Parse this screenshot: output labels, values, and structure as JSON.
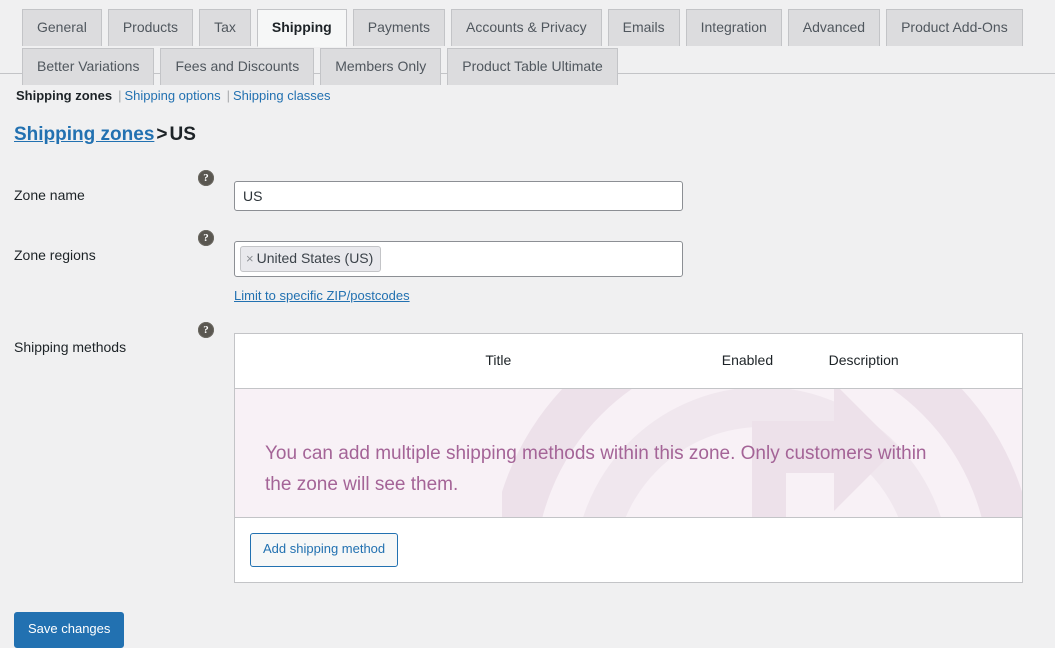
{
  "tabs": {
    "row1": [
      {
        "label": "General",
        "active": false
      },
      {
        "label": "Products",
        "active": false
      },
      {
        "label": "Tax",
        "active": false
      },
      {
        "label": "Shipping",
        "active": true
      },
      {
        "label": "Payments",
        "active": false
      },
      {
        "label": "Accounts & Privacy",
        "active": false
      },
      {
        "label": "Emails",
        "active": false
      },
      {
        "label": "Integration",
        "active": false
      },
      {
        "label": "Advanced",
        "active": false
      },
      {
        "label": "Product Add-Ons",
        "active": false
      }
    ],
    "row2": [
      {
        "label": "Better Variations",
        "active": false
      },
      {
        "label": "Fees and Discounts",
        "active": false
      },
      {
        "label": "Members Only",
        "active": false
      },
      {
        "label": "Product Table Ultimate",
        "active": false
      }
    ]
  },
  "subnav": {
    "items": [
      {
        "label": "Shipping zones",
        "current": true
      },
      {
        "label": "Shipping options",
        "current": false
      },
      {
        "label": "Shipping classes",
        "current": false
      }
    ],
    "separator": "|"
  },
  "breadcrumb": {
    "parent_link": "Shipping zones",
    "separator": ">",
    "current": "US"
  },
  "form": {
    "zone_name": {
      "label": "Zone name",
      "value": "US",
      "placeholder": "Zone name",
      "help": "?"
    },
    "zone_regions": {
      "label": "Zone regions",
      "help": "?",
      "tokens": [
        {
          "remove": "×",
          "label": "United States (US)"
        }
      ],
      "limit_link": "Limit to specific ZIP/postcodes"
    },
    "shipping_methods": {
      "label": "Shipping methods",
      "help": "?",
      "columns": [
        "",
        "Title",
        "Enabled",
        "Description"
      ],
      "empty_message": "You can add multiple shipping methods within this zone. Only customers within the zone will see them.",
      "add_button": "Add shipping method"
    }
  },
  "footer": {
    "save_button": "Save changes"
  },
  "colors": {
    "accent": "#2271b1",
    "page_bg": "#f0f0f1",
    "tab_inactive_bg": "#dcdcde",
    "tab_active_bg": "#f6f7f7",
    "empty_bg": "#f8f1f6",
    "empty_text": "#a46497",
    "border": "#c3c4c7"
  }
}
